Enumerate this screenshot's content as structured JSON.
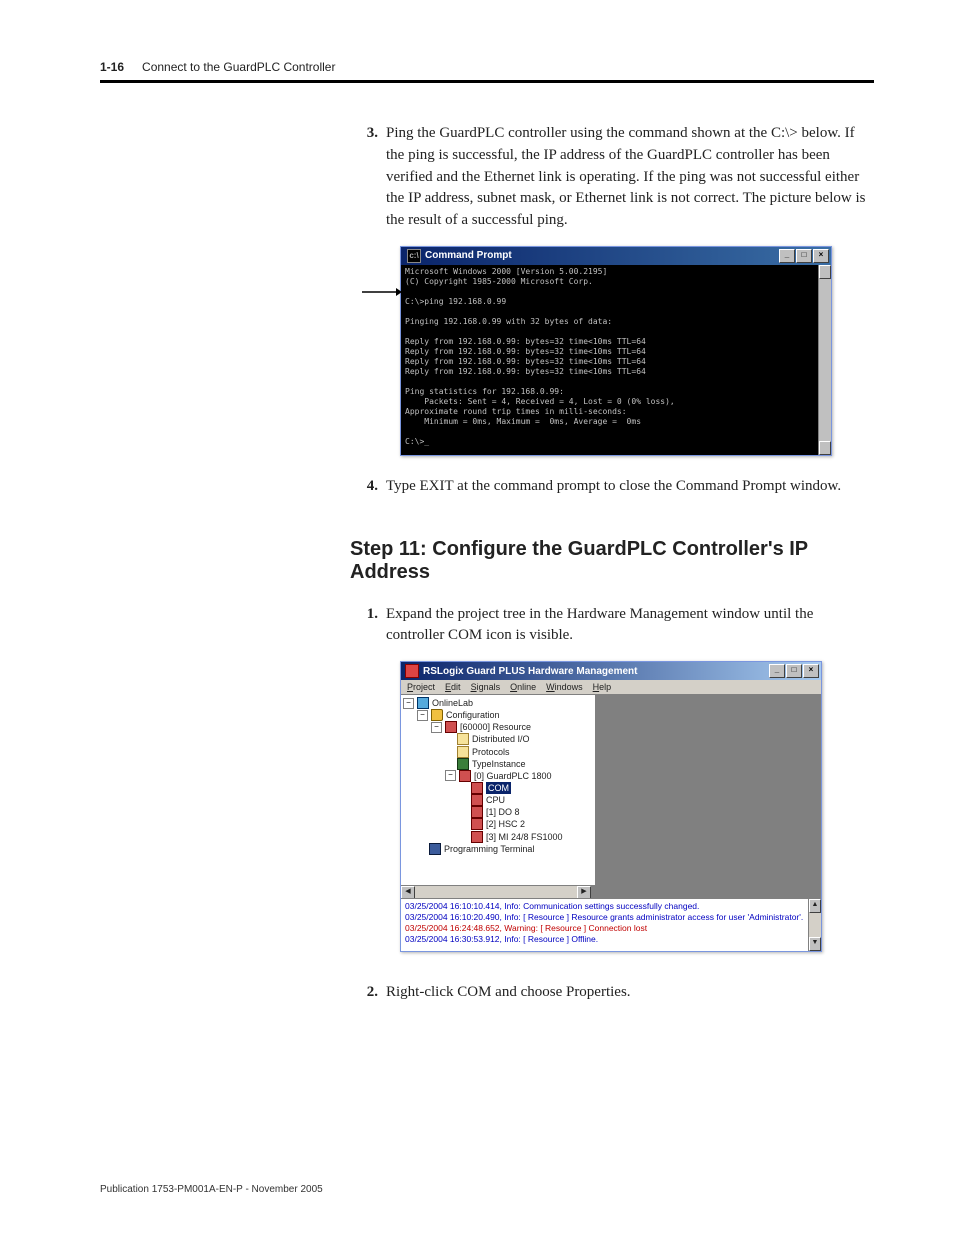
{
  "header": {
    "page_number": "1-16",
    "chapter_title": "Connect to the GuardPLC Controller"
  },
  "step3": {
    "number": "3.",
    "text": "Ping the GuardPLC controller using the command shown at the C:\\> below. If the ping is successful, the IP address of the GuardPLC controller has been verified and the Ethernet link is operating. If the ping was not successful either the IP address, subnet mask, or Ethernet link is not correct. The picture below is the result of a successful ping."
  },
  "cmd": {
    "title": "Command Prompt",
    "body": "Microsoft Windows 2000 [Version 5.00.2195]\n(C) Copyright 1985-2000 Microsoft Corp.\n\nC:\\>ping 192.168.0.99\n\nPinging 192.168.0.99 with 32 bytes of data:\n\nReply from 192.168.0.99: bytes=32 time<10ms TTL=64\nReply from 192.168.0.99: bytes=32 time<10ms TTL=64\nReply from 192.168.0.99: bytes=32 time<10ms TTL=64\nReply from 192.168.0.99: bytes=32 time<10ms TTL=64\n\nPing statistics for 192.168.0.99:\n    Packets: Sent = 4, Received = 4, Lost = 0 (0% loss),\nApproximate round trip times in milli-seconds:\n    Minimum = 0ms, Maximum =  0ms, Average =  0ms\n\nC:\\>_",
    "btn_min": "_",
    "btn_max": "□",
    "btn_close": "×",
    "up": "▲",
    "down": "▼",
    "left": "◀",
    "right": "▶"
  },
  "step4": {
    "number": "4.",
    "text": "Type EXIT at the command prompt to close the Command Prompt window."
  },
  "section11_title": "Step 11: Configure the GuardPLC Controller's IP Address",
  "step1b": {
    "number": "1.",
    "text": "Expand the project tree in the Hardware Management window until the controller COM icon is visible."
  },
  "hw": {
    "title": "RSLogix Guard PLUS Hardware Management",
    "menu": [
      "Project",
      "Edit",
      "Signals",
      "Online",
      "Windows",
      "Help"
    ],
    "tree": {
      "root": "OnlineLab",
      "configuration": "Configuration",
      "resource": "[60000] Resource",
      "dist_io": "Distributed I/O",
      "protocols": "Protocols",
      "typeinstance": "TypeInstance",
      "plc": "[0] GuardPLC 1800",
      "com": "COM",
      "cpu": "CPU",
      "do8": "[1] DO 8",
      "hsc2": "[2] HSC 2",
      "mi": "[3] MI 24/8 FS1000",
      "prog_term": "Programming Terminal"
    },
    "log": [
      {
        "cls": "",
        "text": "03/25/2004 16:10:10.414, Info: Communication settings successfully changed."
      },
      {
        "cls": "",
        "text": "03/25/2004 16:10:20.490, Info: [ Resource ] Resource grants administrator access for user 'Administrator'."
      },
      {
        "cls": "warn",
        "text": "03/25/2004 16:24:48.652, Warning: [ Resource ] Connection lost"
      },
      {
        "cls": "",
        "text": "03/25/2004 16:30:53.912, Info: [ Resource ] Offline."
      }
    ]
  },
  "step2b": {
    "number": "2.",
    "text": "Right-click COM and choose Properties."
  },
  "footer": "Publication 1753-PM001A-EN-P - November 2005"
}
